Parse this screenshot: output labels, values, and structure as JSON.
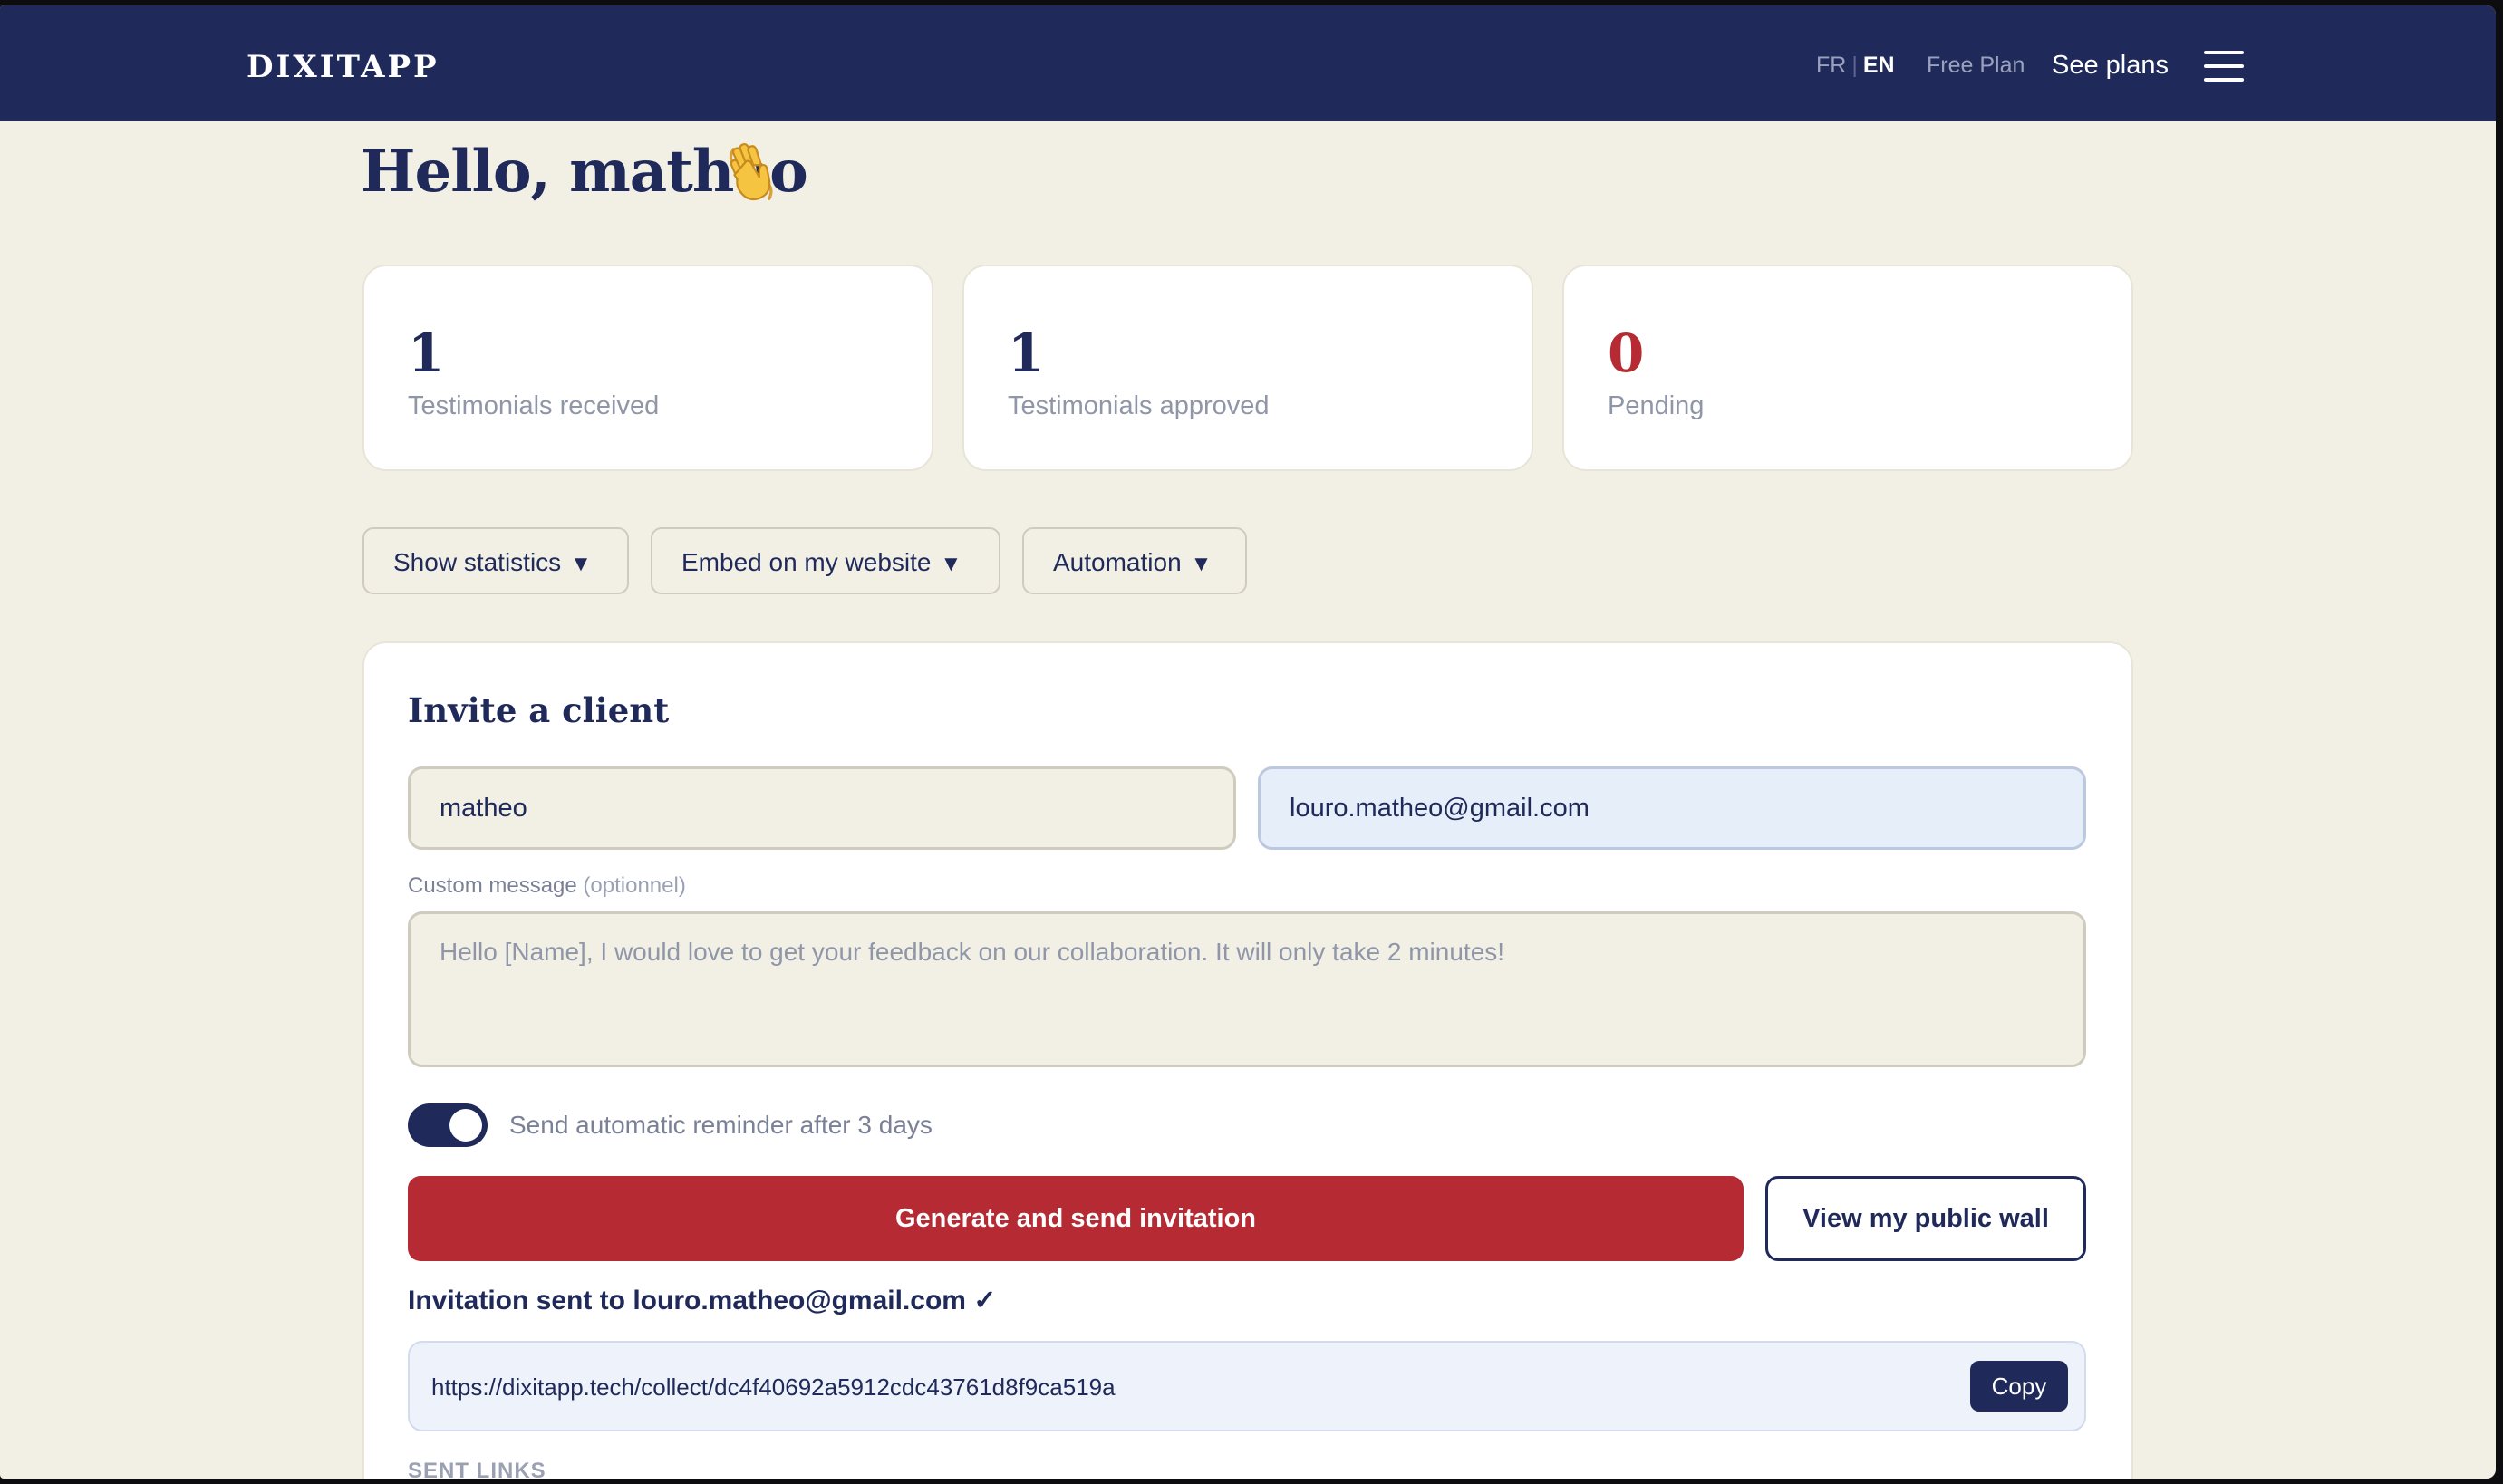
{
  "header": {
    "logo": "DIXITAPP",
    "lang_fr": "FR",
    "lang_en": "EN",
    "plan": "Free Plan",
    "see_plans": "See plans",
    "menu_icon": "hamburger-menu-icon"
  },
  "greeting": "Hello, matheo",
  "greeting_icon": "waving-hand-icon",
  "stats": [
    {
      "value": "1",
      "label": "Testimonials received"
    },
    {
      "value": "1",
      "label": "Testimonials approved"
    },
    {
      "value": "0",
      "label": "Pending"
    }
  ],
  "toolbar": {
    "statistics": "Show statistics",
    "embed": "Embed on my website",
    "automation": "Automation",
    "caret": "▼"
  },
  "invite": {
    "title": "Invite a client",
    "name_value": "matheo",
    "email_value": "louro.matheo@gmail.com",
    "message_label": "Custom message",
    "message_optional": "(optionnel)",
    "message_placeholder": "Hello [Name], I would love to get your feedback on our collaboration. It will only take 2 minutes!",
    "reminder_label": "Send automatic reminder after 3 days",
    "reminder_on": true,
    "generate_button": "Generate and send invitation",
    "wall_button": "View my public wall",
    "sent_message": "Invitation sent to louro.matheo@gmail.com ✓",
    "link_url": "https://dixitapp.tech/collect/dc4f40692a5912cdc43761d8f9ca519a",
    "copy_button": "Copy",
    "sent_links_heading": "SENT LINKS"
  },
  "colors": {
    "navy": "#1f2a5a",
    "red": "#b52a33",
    "background": "#f2efe5"
  }
}
